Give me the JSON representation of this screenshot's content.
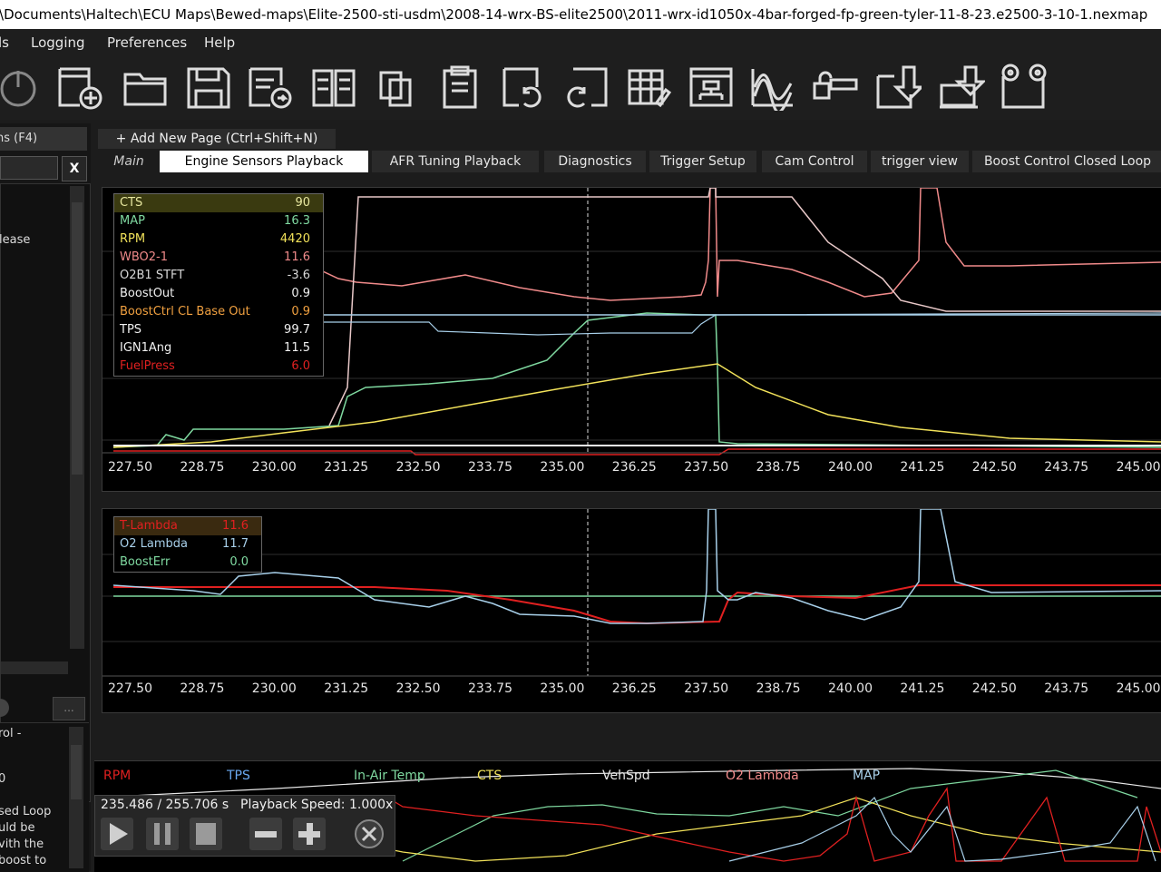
{
  "window": {
    "title": ":\\Documents\\Haltech\\ECU Maps\\Bewed-maps\\Elite-2500-sti-usdm\\2008-14-wrx-BS-elite2500\\2011-wrx-id1050x-4bar-forged-fp-green-tyler-11-8-23.e2500-3-10-1.nexmap"
  },
  "menu": {
    "items": [
      "ls",
      "Logging",
      "Preferences",
      "Help"
    ]
  },
  "toolbar": {
    "icons": [
      "power-icon",
      "new-file-icon",
      "open-folder-icon",
      "save-icon",
      "export-icon",
      "compare-icon",
      "copy-icon",
      "paste-icon",
      "undo-icon",
      "redo-icon",
      "table-edit-icon",
      "connect-icon",
      "graph-icon",
      "key-icon",
      "download-icon",
      "upload-icon",
      "wizard-icon"
    ]
  },
  "left_panel": {
    "header": "ns (F4)",
    "close_label": "X",
    "list_item": "elease",
    "lower_lines": [
      "rol -",
      "0",
      "sed Loop",
      "uld be",
      "vith the",
      "boost to"
    ],
    "more_label": "..."
  },
  "pages": {
    "add_label": "+ Add New Page (Ctrl+Shift+N)",
    "tabs": [
      "Main",
      "Engine Sensors Playback",
      "AFR Tuning Playback",
      "Diagnostics",
      "Trigger Setup",
      "Cam Control",
      "trigger view",
      "Boost Control Closed Loop"
    ],
    "active": "Engine Sensors Playback"
  },
  "graph1": {
    "legend": [
      {
        "name": "CTS",
        "value": "90",
        "color": "#e8e8a0"
      },
      {
        "name": "MAP",
        "value": "16.3",
        "color": "#7fd9a0"
      },
      {
        "name": "RPM",
        "value": "4420",
        "color": "#f2e25a"
      },
      {
        "name": "WBO2-1",
        "value": "11.6",
        "color": "#f08a8a"
      },
      {
        "name": "O2B1 STFT",
        "value": "-3.6",
        "color": "#d8d8d8"
      },
      {
        "name": "BoostOut",
        "value": "0.9",
        "color": "#f0f0f0"
      },
      {
        "name": "BoostCtrl CL Base Out",
        "value": "0.9",
        "color": "#f0a040"
      },
      {
        "name": "TPS",
        "value": "99.7",
        "color": "#f0f0f0"
      },
      {
        "name": "IGN1Ang",
        "value": "11.5",
        "color": "#f0f0f0"
      },
      {
        "name": "FuelPress",
        "value": "6.0",
        "color": "#e02020"
      }
    ],
    "x_ticks": [
      "227.50",
      "228.75",
      "230.00",
      "231.25",
      "232.50",
      "233.75",
      "235.00",
      "236.25",
      "237.50",
      "238.75",
      "240.00",
      "241.25",
      "242.50",
      "243.75",
      "245.00"
    ]
  },
  "graph2": {
    "legend": [
      {
        "name": "T-Lambda",
        "value": "11.6",
        "color": "#e02020"
      },
      {
        "name": "O2 Lambda",
        "value": "11.7",
        "color": "#a8d0ea"
      },
      {
        "name": "BoostErr",
        "value": "0.0",
        "color": "#7fd9a0"
      }
    ],
    "x_ticks": [
      "227.50",
      "228.75",
      "230.00",
      "231.25",
      "232.50",
      "233.75",
      "235.00",
      "236.25",
      "237.50",
      "238.75",
      "240.00",
      "241.25",
      "242.50",
      "243.75",
      "245.00"
    ]
  },
  "strip": {
    "labels": [
      {
        "text": "RPM",
        "color": "#e02020"
      },
      {
        "text": "TPS",
        "color": "#6aa8f0"
      },
      {
        "text": "In-Air Temp",
        "color": "#7fd9a0"
      },
      {
        "text": "CTS",
        "color": "#f2e25a"
      },
      {
        "text": "VehSpd",
        "color": "#e8e8e8"
      },
      {
        "text": "O2 Lambda",
        "color": "#f08a8a"
      },
      {
        "text": "MAP",
        "color": "#a8d0ea"
      }
    ]
  },
  "playback": {
    "time": "235.486 / 255.706 s",
    "speed": "Playback Speed: 1.000x"
  }
}
